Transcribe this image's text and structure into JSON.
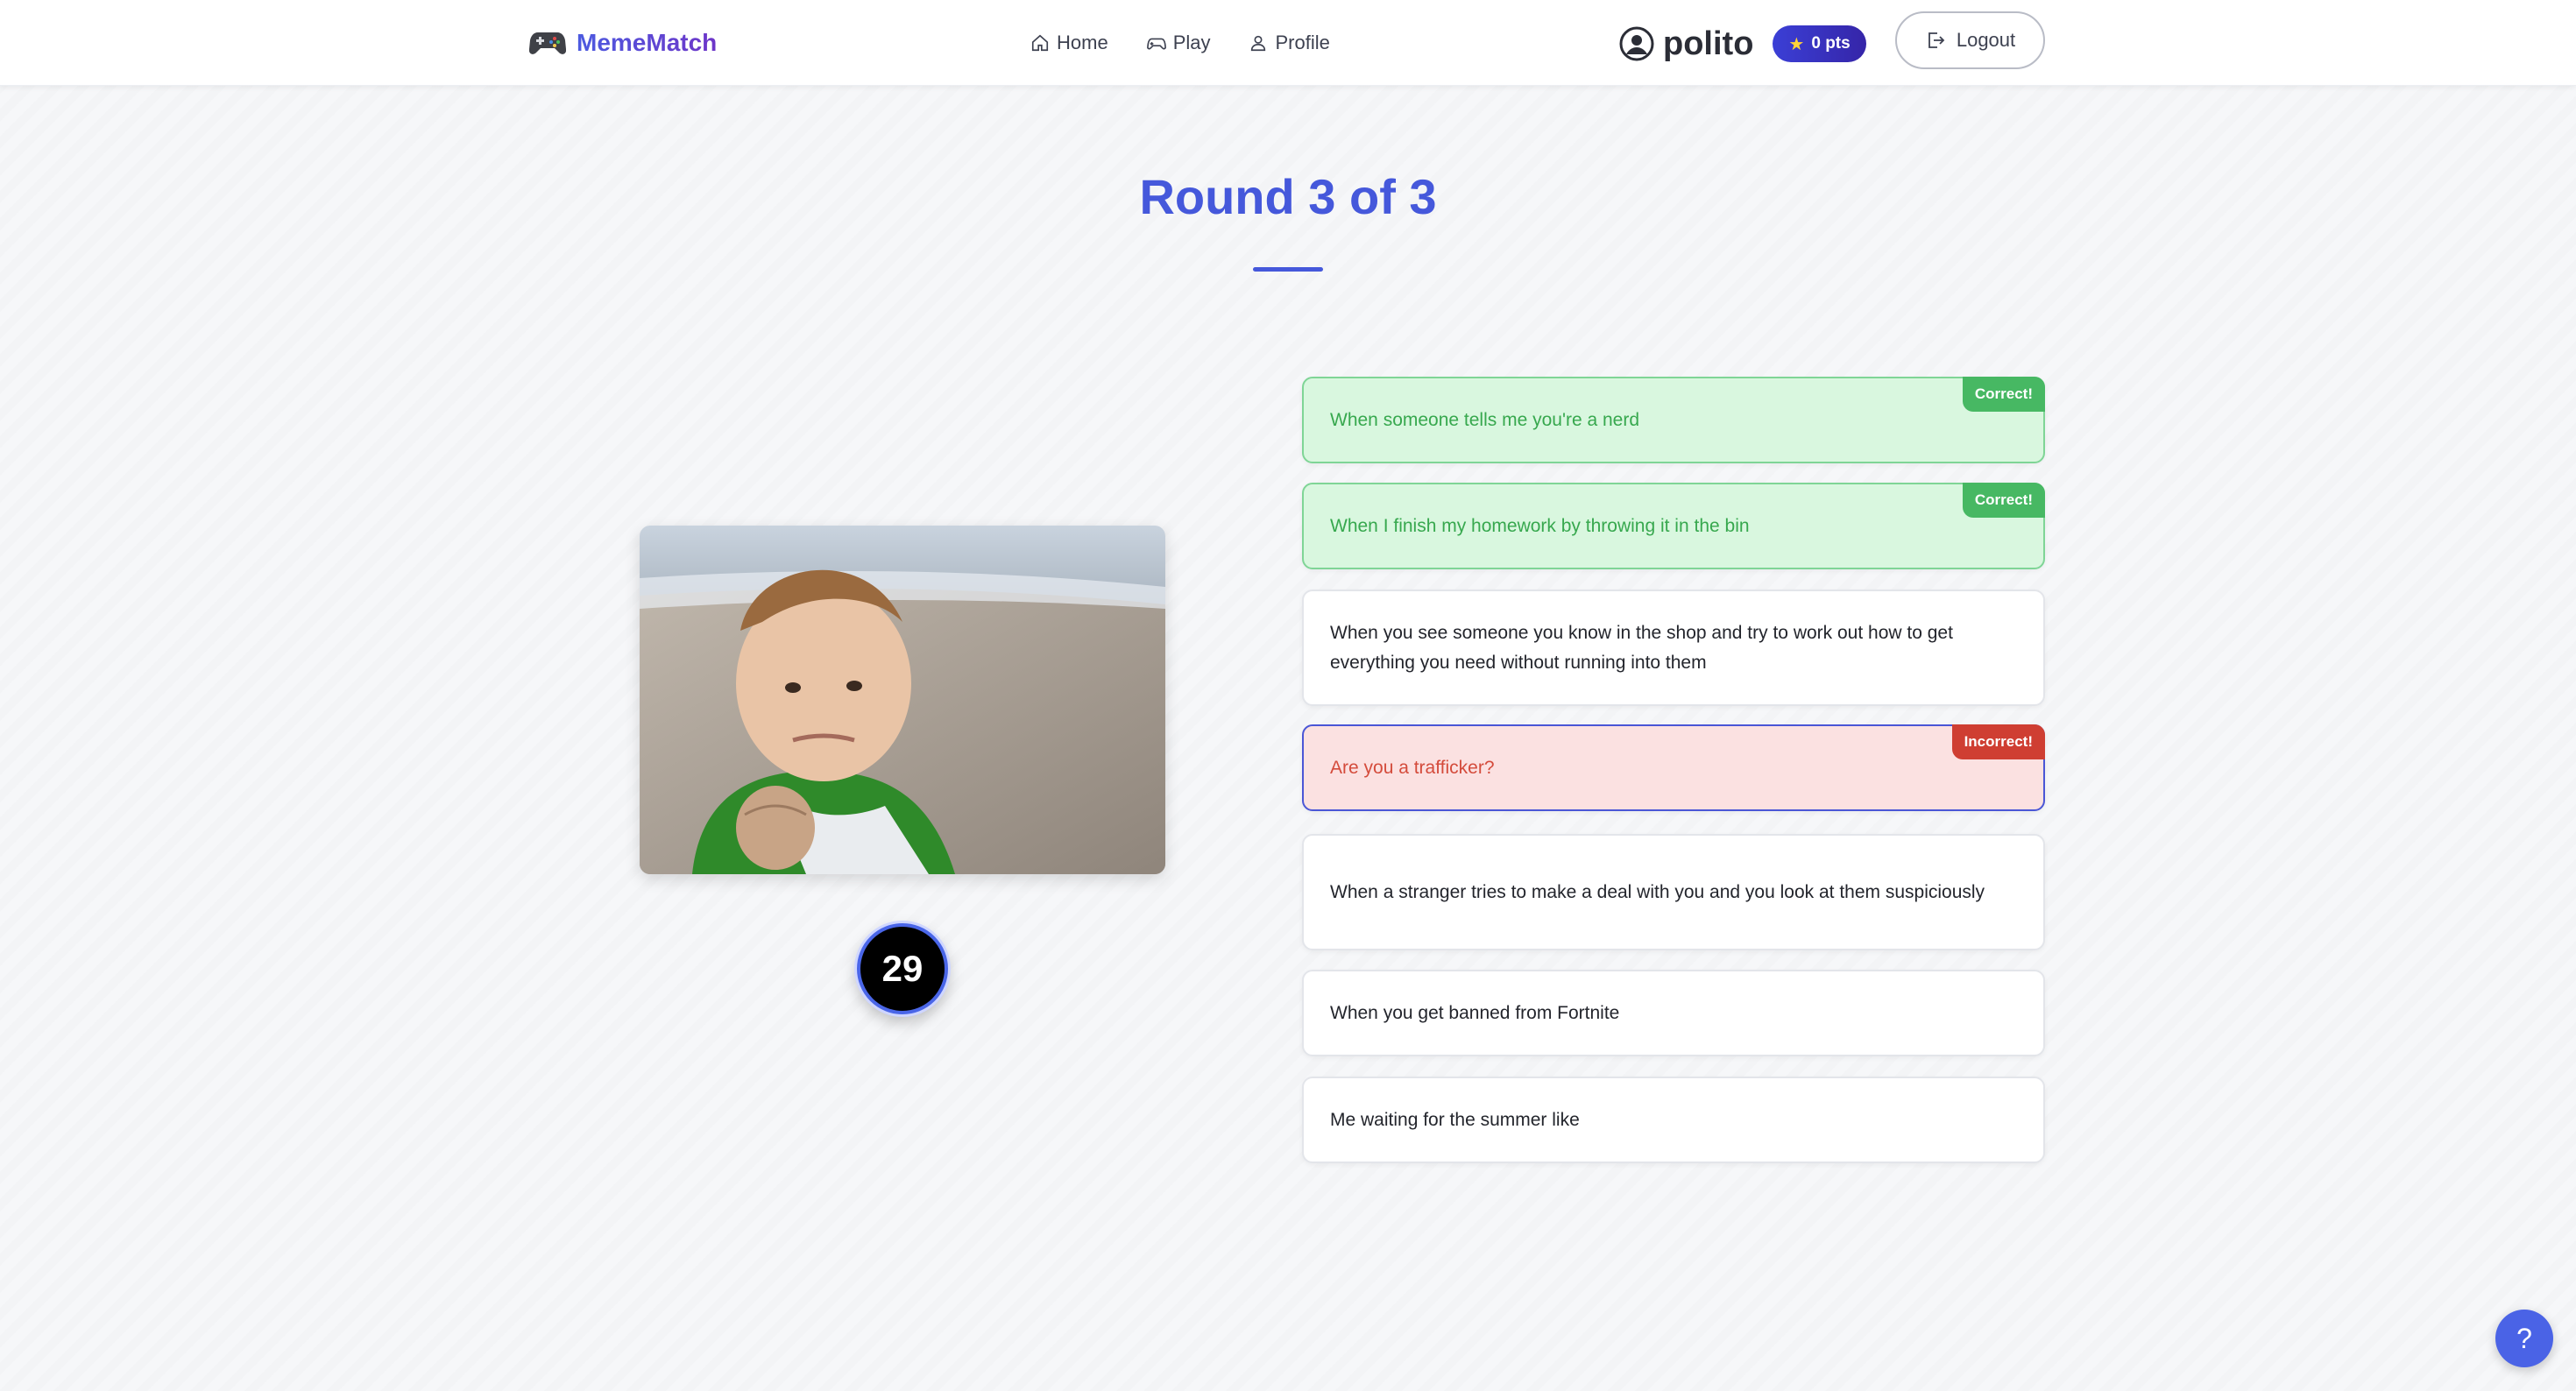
{
  "navbar": {
    "brand": "MemeMatch",
    "links": [
      {
        "label": "Home",
        "icon": "home-icon"
      },
      {
        "label": "Play",
        "icon": "gamepad-icon"
      },
      {
        "label": "Profile",
        "icon": "person-icon"
      }
    ],
    "username": "polito",
    "points": "0 pts",
    "logout_label": "Logout"
  },
  "game": {
    "round_title": "Round 3 of 3",
    "timer": "29",
    "meme_image": "success-kid-meme",
    "captions": [
      {
        "text": "When someone tells me you're a nerd",
        "status": "correct",
        "badge": "Correct!"
      },
      {
        "text": "When I finish my homework by throwing it in the bin",
        "status": "correct",
        "badge": "Correct!"
      },
      {
        "text": "When you see someone you know in the shop and try to work out how to get everything you need without running into them",
        "status": "neutral",
        "badge": ""
      },
      {
        "text": "Are you a trafficker?",
        "status": "incorrect",
        "badge": "Incorrect!"
      },
      {
        "text": "When a stranger tries to make a deal with you and you look at them suspiciously",
        "status": "neutral",
        "badge": ""
      },
      {
        "text": "When you get banned from Fortnite",
        "status": "neutral",
        "badge": ""
      },
      {
        "text": "Me waiting for the summer like",
        "status": "neutral",
        "badge": ""
      }
    ]
  },
  "help_label": "?",
  "colors": {
    "accent": "#4558db",
    "correct_bg": "#d9f7df",
    "correct_text": "#37a84e",
    "incorrect_bg": "#fbe1e1",
    "incorrect_text": "#d44b3b"
  }
}
